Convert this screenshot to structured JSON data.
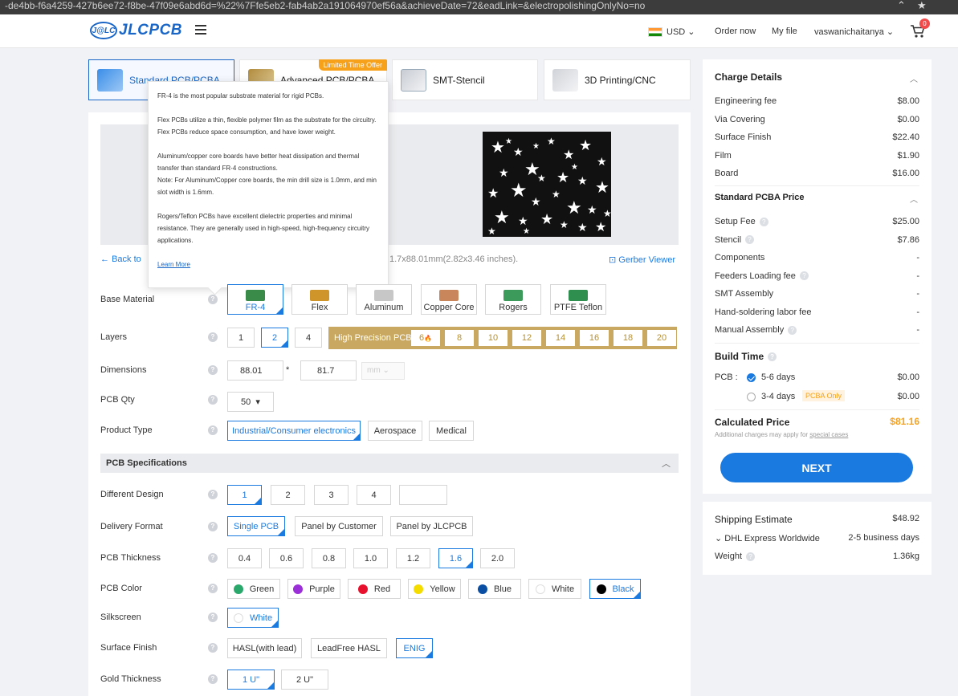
{
  "browser": {
    "url_fragment": "-de4bb-f6a4259-427b6ee72-f8be-47f09e6abd6d=%22%7Ffe5eb2-fab4ab2a191064970ef56a&achieveDate=72&eadLink=&electropolishingOnlyNo=no"
  },
  "header": {
    "logo_mark": "J@LC",
    "logo_text": "JLCPCB",
    "currency": "USD",
    "order_now": "Order now",
    "my_file": "My file",
    "user": "vaswanichaitanya",
    "cart_count": "0"
  },
  "tabs": [
    {
      "label": "Standard PCB/PCBA",
      "active": true
    },
    {
      "label": "Advanced PCB/PCBA",
      "badge": "Limited Time Offer"
    },
    {
      "label": "SMT-Stencil"
    },
    {
      "label": "3D Printing/CNC"
    }
  ],
  "tooltip": {
    "p1": "FR-4 is the most popular substrate material for rigid PCBs.",
    "p2": "Flex PCBs utilize a thin, flexible polymer film as the substrate for the circuitry. Flex PCBs reduce space consumption, and have lower weight.",
    "p3": "Aluminum/copper core boards have better heat dissipation and thermal transfer than standard FR-4 constructions.",
    "p3b": "Note: For Aluminum/Copper core boards, the min drill size is 1.0mm, and min slot width is 1.6mm.",
    "p4": "Rogers/Teflon PCBs have excellent dielectric properties and minimal resistance. They are generally used in high-speed, high-frequency circuitry applications.",
    "learn_more": "Learn More"
  },
  "preview": {
    "back": "Back to",
    "size_text": "1.7x88.01mm(2.82x3.46 inches).",
    "gerber_viewer": "Gerber Viewer"
  },
  "form": {
    "base_material": {
      "label": "Base Material",
      "options": [
        "FR-4",
        "Flex",
        "Aluminum",
        "Copper Core",
        "Rogers",
        "PTFE Teflon"
      ],
      "selected": "FR-4"
    },
    "layers": {
      "label": "Layers",
      "options": [
        "1",
        "2",
        "4"
      ],
      "selected": "2",
      "hp_label": "High Precision PCB",
      "hp_options": [
        "6",
        "8",
        "10",
        "12",
        "14",
        "16",
        "18",
        "20"
      ]
    },
    "dimensions": {
      "label": "Dimensions",
      "x": "88.01",
      "times": "*",
      "y": "81.7",
      "unit": "mm"
    },
    "qty": {
      "label": "PCB Qty",
      "value": "50"
    },
    "product_type": {
      "label": "Product Type",
      "options": [
        "Industrial/Consumer electronics",
        "Aerospace",
        "Medical"
      ],
      "selected": "Industrial/Consumer electronics"
    },
    "spec_title": "PCB Specifications",
    "design": {
      "label": "Different Design",
      "options": [
        "1",
        "2",
        "3",
        "4",
        ""
      ],
      "selected": "1"
    },
    "delivery": {
      "label": "Delivery Format",
      "options": [
        "Single PCB",
        "Panel by Customer",
        "Panel by JLCPCB"
      ],
      "selected": "Single PCB"
    },
    "thickness": {
      "label": "PCB Thickness",
      "options": [
        "0.4",
        "0.6",
        "0.8",
        "1.0",
        "1.2",
        "1.6",
        "2.0"
      ],
      "selected": "1.6"
    },
    "color": {
      "label": "PCB Color",
      "options": [
        {
          "name": "Green",
          "hex": "#2aa86b"
        },
        {
          "name": "Purple",
          "hex": "#9b30d9"
        },
        {
          "name": "Red",
          "hex": "#e8112d"
        },
        {
          "name": "Yellow",
          "hex": "#f5dc00"
        },
        {
          "name": "Blue",
          "hex": "#0a4ea3"
        },
        {
          "name": "White",
          "hex": "#ffffff"
        },
        {
          "name": "Black",
          "hex": "#000000"
        }
      ],
      "selected": "Black"
    },
    "silkscreen": {
      "label": "Silkscreen",
      "value": "White"
    },
    "surface": {
      "label": "Surface Finish",
      "options": [
        "HASL(with lead)",
        "LeadFree HASL",
        "ENIG"
      ],
      "selected": "ENIG"
    },
    "gold": {
      "label": "Gold Thickness",
      "options": [
        "1 U\"",
        "2 U\""
      ],
      "selected": "1 U\""
    }
  },
  "charges": {
    "title": "Charge Details",
    "items": [
      {
        "name": "Engineering fee",
        "value": "$8.00"
      },
      {
        "name": "Via Covering",
        "value": "$0.00"
      },
      {
        "name": "Surface Finish",
        "value": "$22.40"
      },
      {
        "name": "Film",
        "value": "$1.90"
      },
      {
        "name": "Board",
        "value": "$16.00"
      }
    ],
    "pcba_title": "Standard PCBA Price",
    "pcba_items": [
      {
        "name": "Setup Fee",
        "value": "$25.00",
        "help": true
      },
      {
        "name": "Stencil",
        "value": "$7.86",
        "help": true
      },
      {
        "name": "Components",
        "value": "-"
      },
      {
        "name": "Feeders Loading fee",
        "value": "-",
        "help": true
      },
      {
        "name": "SMT Assembly",
        "value": "-"
      },
      {
        "name": "Hand-soldering labor fee",
        "value": "-"
      },
      {
        "name": "Manual Assembly",
        "value": "-",
        "help": true
      }
    ],
    "build_time_title": "Build Time",
    "build_prefix": "PCB :",
    "build_options": [
      {
        "label": "5-6 days",
        "value": "$0.00",
        "selected": true
      },
      {
        "label": "3-4 days",
        "value": "$0.00",
        "tag": "PCBA Only"
      }
    ],
    "calculated_label": "Calculated Price",
    "calculated_value": "$81.16",
    "additional_note": "Additional charges may apply for",
    "special_cases": "special cases",
    "next": "NEXT"
  },
  "shipping": {
    "title": "Shipping Estimate",
    "price": "$48.92",
    "method": "DHL Express Worldwide",
    "time": "2-5 business days",
    "weight_label": "Weight",
    "weight": "1.36kg"
  },
  "colors": {
    "accent": "#1a7ae0",
    "price": "#f7a11b",
    "hp_gold": "#c9a962"
  }
}
